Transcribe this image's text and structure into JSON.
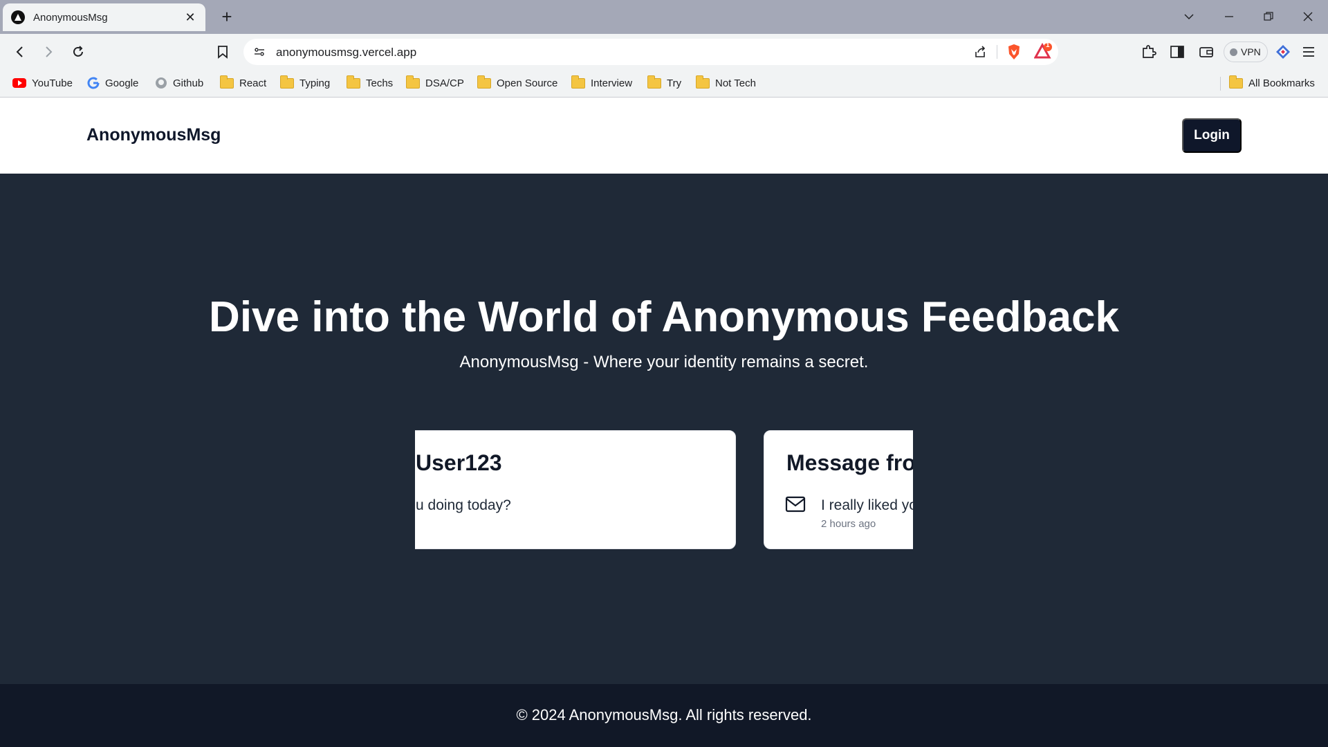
{
  "browser": {
    "tab": {
      "title": "AnonymousMsg",
      "close_symbol": "✕"
    },
    "new_tab_symbol": "+",
    "url": "anonymousmsg.vercel.app",
    "vpn_label": "VPN",
    "rewards_badge": "1"
  },
  "bookmarks": {
    "items": [
      {
        "label": "YouTube",
        "icon": "youtube-icon"
      },
      {
        "label": "Google",
        "icon": "google-icon"
      },
      {
        "label": "Github",
        "icon": "github-icon"
      },
      {
        "label": "React",
        "icon": "folder-icon"
      },
      {
        "label": "Typing",
        "icon": "folder-icon"
      },
      {
        "label": "Techs",
        "icon": "folder-icon"
      },
      {
        "label": "DSA/CP",
        "icon": "folder-icon"
      },
      {
        "label": "Open Source",
        "icon": "folder-icon"
      },
      {
        "label": "Interview",
        "icon": "folder-icon"
      },
      {
        "label": "Try",
        "icon": "folder-icon"
      },
      {
        "label": "Not Tech",
        "icon": "folder-icon"
      }
    ],
    "all_bookmarks": "All Bookmarks"
  },
  "site": {
    "brand": "AnonymousMsg",
    "login_label": "Login"
  },
  "hero": {
    "title": "Dive into the World of Anonymous Feedback",
    "subtitle": "AnonymousMsg - Where your identity remains a secret."
  },
  "cards": [
    {
      "title": "User123",
      "message": "u doing today?",
      "time": ""
    },
    {
      "title": "Message fron",
      "message": "I really liked yo",
      "time": "2 hours ago"
    }
  ],
  "footer": {
    "text": "© 2024 AnonymousMsg. All rights reserved."
  },
  "colors": {
    "hero_bg": "#1f2937",
    "footer_bg": "#111827",
    "button_bg": "#0f172a",
    "brave_orange": "#fb542b"
  }
}
